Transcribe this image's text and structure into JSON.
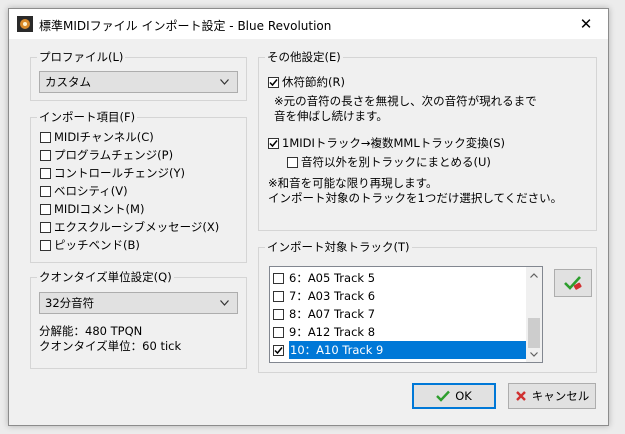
{
  "window": {
    "title": "標準MIDIファイル インポート設定 - Blue Revolution",
    "close_glyph": "✕"
  },
  "profile": {
    "label": "プロファイル(L)",
    "value": "カスタム"
  },
  "import_items": {
    "label": "インポート項目(F)",
    "items": [
      {
        "label": "MIDIチャンネル(C)",
        "checked": false
      },
      {
        "label": "プログラムチェンジ(P)",
        "checked": false
      },
      {
        "label": "コントロールチェンジ(Y)",
        "checked": false
      },
      {
        "label": "ベロシティ(V)",
        "checked": false
      },
      {
        "label": "MIDIコメント(M)",
        "checked": false
      },
      {
        "label": "エクスクルーシブメッセージ(X)",
        "checked": false
      },
      {
        "label": "ピッチベンド(B)",
        "checked": false
      }
    ]
  },
  "quantize": {
    "label": "クオンタイズ単位設定(Q)",
    "value": "32分音符",
    "resolution": "分解能：480 TPQN",
    "unit": "クオンタイズ単位：60 tick"
  },
  "other": {
    "label": "その他設定(E)",
    "rest_saving": {
      "label": "休符節約(R)",
      "checked": true
    },
    "rest_note_1": "※元の音符の長さを無視し、次の音符が現れるまで",
    "rest_note_2": "音を伸ばし続けます。",
    "multi_track": {
      "label": "1MIDIトラック→複数MMLトラック変換(S)",
      "checked": true
    },
    "separate": {
      "label": "音符以外を別トラックにまとめる(U)",
      "checked": false
    },
    "chord_note_1": "※和音を可能な限り再現します。",
    "chord_note_2": "インポート対象のトラックを1つだけ選択してください。"
  },
  "tracks": {
    "label": "インポート対象トラック(T)",
    "rows": [
      {
        "label": "6：A05 Track 5",
        "checked": false,
        "selected": false
      },
      {
        "label": "7：A03 Track 6",
        "checked": false,
        "selected": false
      },
      {
        "label": "8：A07 Track 7",
        "checked": false,
        "selected": false
      },
      {
        "label": "9：A12 Track 8",
        "checked": false,
        "selected": false
      },
      {
        "label": "10：A10 Track 9",
        "checked": true,
        "selected": true
      }
    ]
  },
  "buttons": {
    "ok": "OK",
    "cancel": "キャンセル"
  },
  "colors": {
    "accent": "#0078d7",
    "check_green": "#2e9e2e",
    "cancel_red": "#d03030"
  }
}
